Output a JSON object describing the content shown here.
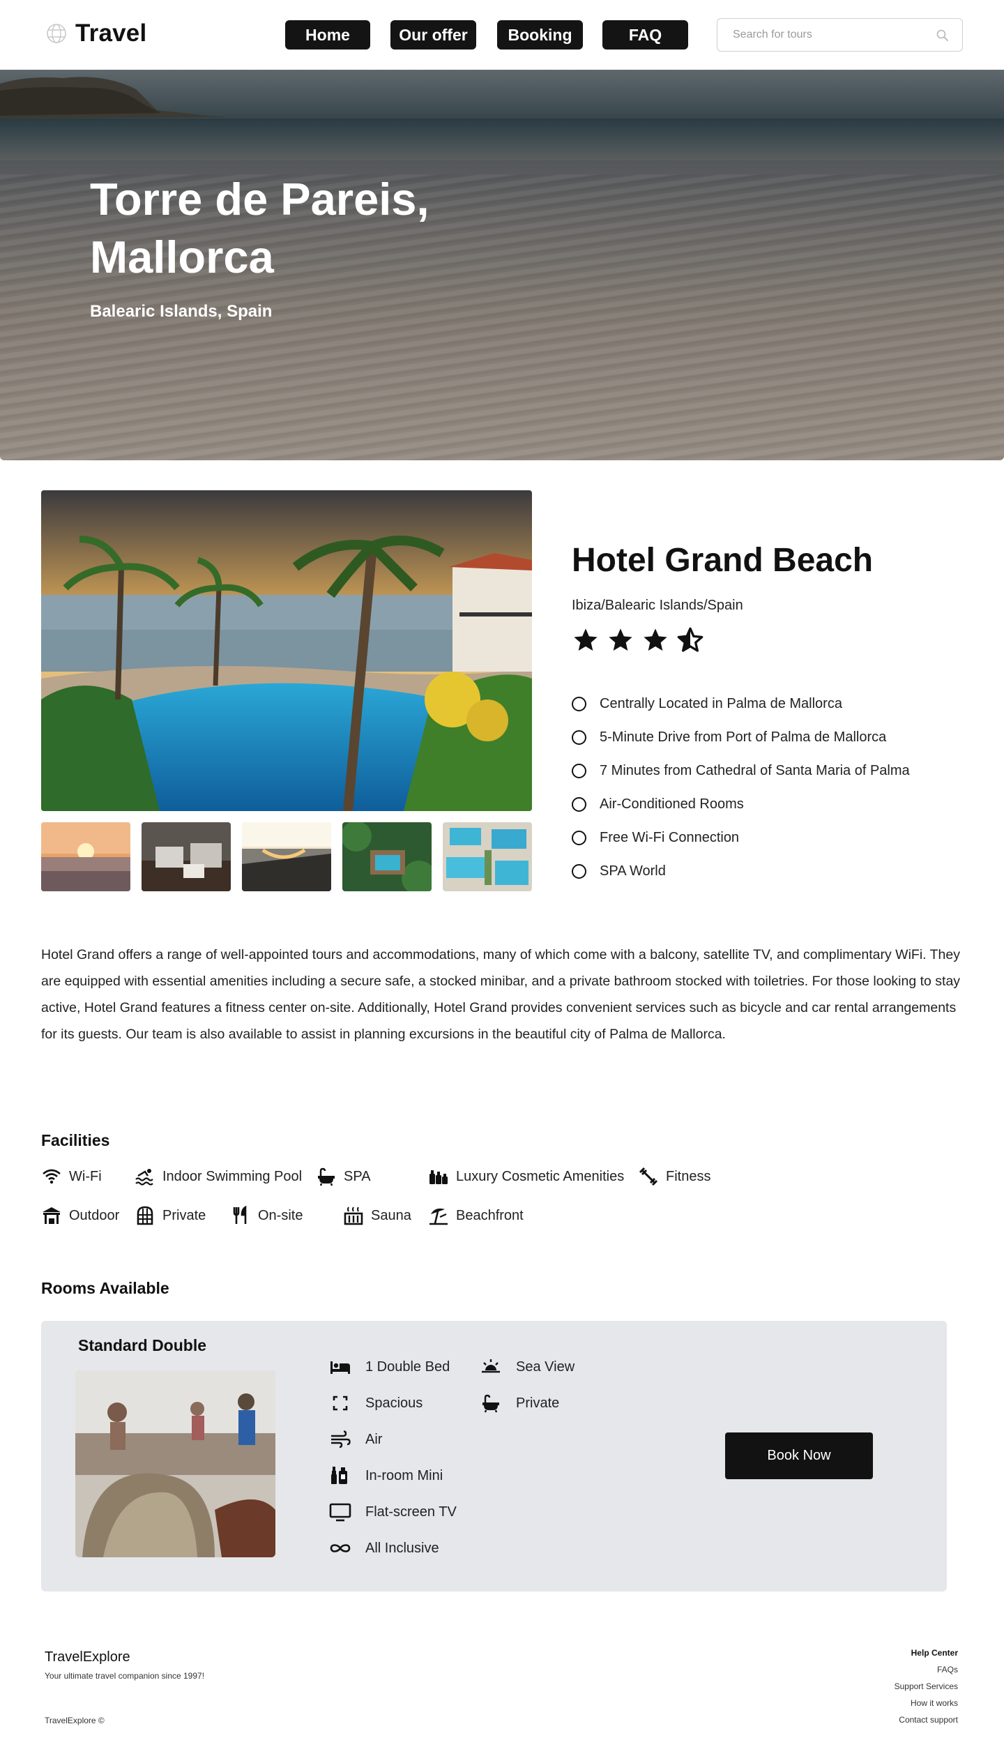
{
  "header": {
    "logo_text": "Travel",
    "nav": [
      "Home",
      "Our offer",
      "Booking",
      "FAQ"
    ],
    "search_placeholder": "Search for tours"
  },
  "hero": {
    "title_line1": "Torre de Pareis,",
    "title_line2": "Mallorca",
    "subtitle": "Balearic Islands, Spain"
  },
  "hotel": {
    "name": "Hotel Grand Beach",
    "location": "Ibiza/Balearic Islands/Spain",
    "rating": 3.5,
    "rating_max": 4,
    "features": [
      "Centrally Located in Palma de Mallorca",
      "5-Minute Drive from Port of Palma de Mallorca",
      "7 Minutes from Cathedral of Santa Maria of Palma",
      "Air-Conditioned Rooms",
      "Free Wi-Fi Connection",
      "SPA World"
    ],
    "description": "Hotel Grand offers a range of well-appointed tours and accommodations, many of which come with a balcony, satellite TV, and complimentary WiFi. They are equipped with essential amenities including a secure safe, a stocked minibar, and a private bathroom stocked with toiletries. For those looking to stay active, Hotel Grand features a fitness center on-site. Additionally, Hotel Grand provides convenient services such as bicycle and car rental arrangements for its guests. Our team is also available to assist in planning excursions in the beautiful city of Palma de Mallorca."
  },
  "facilities": {
    "title": "Facilities",
    "items": [
      {
        "label": "Wi-Fi",
        "icon": "wifi-icon"
      },
      {
        "label": "Indoor Swimming Pool",
        "icon": "pool-icon"
      },
      {
        "label": "SPA",
        "icon": "bathtub-icon"
      },
      {
        "label": "Luxury Cosmetic Amenities",
        "icon": "cosmetics-icon"
      },
      {
        "label": "Fitness",
        "icon": "fitness-icon"
      },
      {
        "label": "Outdoor",
        "icon": "outdoor-icon"
      },
      {
        "label": "Private",
        "icon": "private-icon"
      },
      {
        "label": "On-site",
        "icon": "restaurant-icon"
      },
      {
        "label": "Sauna",
        "icon": "sauna-icon"
      },
      {
        "label": "Beachfront",
        "icon": "beach-umbrella-icon"
      }
    ]
  },
  "rooms": {
    "title": "Rooms Available",
    "room": {
      "name": "Standard Double",
      "amenities": [
        {
          "label": "1 Double Bed",
          "icon": "bed-icon"
        },
        {
          "label": "Spacious",
          "icon": "expand-icon"
        },
        {
          "label": "Air",
          "icon": "air-icon"
        },
        {
          "label": "In-room Mini",
          "icon": "minibar-icon"
        },
        {
          "label": "Flat-screen TV",
          "icon": "tv-icon"
        },
        {
          "label": "All Inclusive",
          "icon": "infinity-icon"
        },
        {
          "label": "Sea View",
          "icon": "sunrise-icon"
        },
        {
          "label": "Private",
          "icon": "bathtub-icon"
        }
      ],
      "book_label": "Book Now"
    }
  },
  "footer": {
    "brand": "TravelExplore",
    "tagline": "Your ultimate travel companion since 1997!",
    "copyright": "TravelExplore ©",
    "links_title": "Help Center",
    "links": [
      "FAQs",
      "Support Services",
      "How it works",
      "Contact support"
    ]
  }
}
